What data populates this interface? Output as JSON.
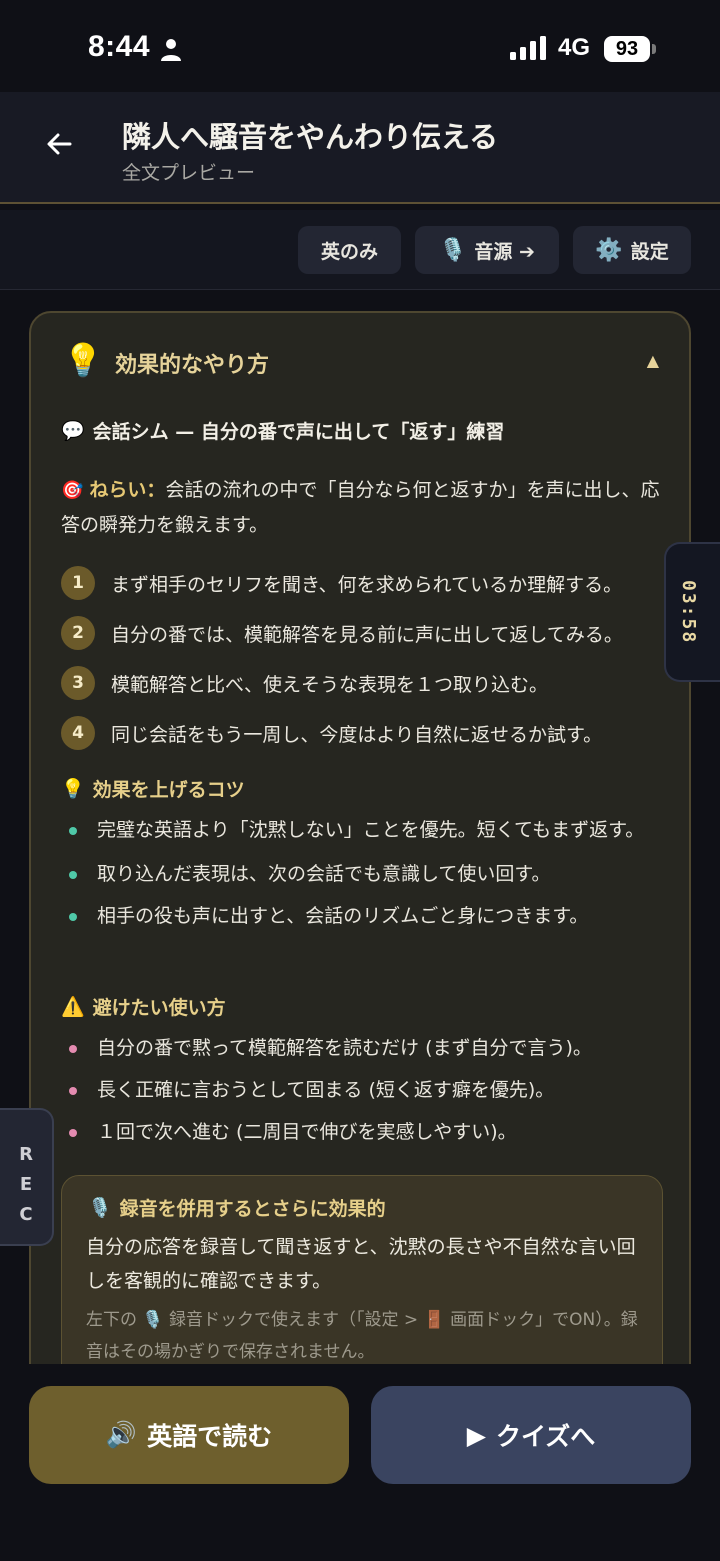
{
  "status_bar": {
    "time": "8:44",
    "network": "4G",
    "battery": "93"
  },
  "header": {
    "title": "隣人へ騒音をやんわり伝える",
    "subtitle": "全文プレビュー"
  },
  "toolbar": {
    "english_only": "英のみ",
    "audio_source": "音源 ➔",
    "settings": "設定"
  },
  "card": {
    "title": "効果的なやり方",
    "mode_heading": "会話シム — 自分の番で声に出して「返す」練習",
    "goal_label": "ねらい：",
    "goal_text": "会話の流れの中で「自分なら何と返すか」を声に出し、応答の瞬発力を鍛えます。",
    "steps": [
      {
        "num": "1",
        "text": "まず相手のセリフを聞き、何を求められているか理解する。"
      },
      {
        "num": "2",
        "text": "自分の番では、模範解答を見る前に声に出して返してみる。"
      },
      {
        "num": "3",
        "text": "模範解答と比べ、使えそうな表現を１つ取り込む。"
      },
      {
        "num": "4",
        "text": "同じ会話をもう一周し、今度はより自然に返せるか試す。"
      }
    ],
    "tips_heading": "効果を上げるコツ",
    "tips": [
      "完璧な英語より「沈黙しない」ことを優先。短くてもまず返す。",
      "取り込んだ表現は、次の会話でも意識して使い回す。",
      "相手の役も声に出すと、会話のリズムごと身につきます。"
    ],
    "avoid_heading": "避けたい使い方",
    "avoid": [
      "自分の番で黙って模範解答を読むだけ (まず自分で言う)。",
      "長く正確に言おうとして固まる (短く返す癖を優先)。",
      "１回で次へ進む (二周目で伸びを実感しやすい)。"
    ],
    "recording": {
      "title": "録音を併用するとさらに効果的",
      "body": "自分の応答を録音して聞き返すと、沈黙の長さや不自然な言い回しを客観的に確認できます。",
      "note_prefix": "左下の",
      "note_mid1": "録音ドックで使えます（「設定 >",
      "note_mid2": "画面ドック」でON）。録音はその場かぎりで保存されません。"
    }
  },
  "timer": "03:58",
  "rec_tab": "REC",
  "bottom": {
    "read_english": "英語で読む",
    "to_quiz": "クイズへ"
  },
  "colors": {
    "accent_gold": "#e6d39a",
    "tip_dot": "#4fc9a8",
    "avoid_dot": "#e48bb0",
    "read_btn": "#6e5f2d",
    "quiz_btn": "#3a4460"
  }
}
